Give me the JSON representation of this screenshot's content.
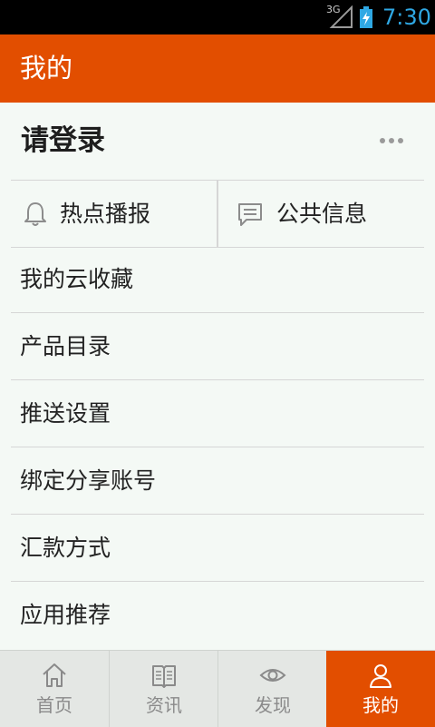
{
  "status_bar": {
    "network": "3G",
    "time": "7:30"
  },
  "app_bar": {
    "title": "我的"
  },
  "login": {
    "label": "请登录",
    "more_icon": "more-dots-icon"
  },
  "quick_actions": [
    {
      "label": "热点播报",
      "icon": "bell-icon"
    },
    {
      "label": "公共信息",
      "icon": "message-icon"
    }
  ],
  "menu": [
    {
      "label": "我的云收藏"
    },
    {
      "label": "产品目录"
    },
    {
      "label": "推送设置"
    },
    {
      "label": "绑定分享账号"
    },
    {
      "label": "汇款方式"
    },
    {
      "label": "应用推荐"
    }
  ],
  "tabs": [
    {
      "label": "首页",
      "icon": "home-icon",
      "active": false
    },
    {
      "label": "资讯",
      "icon": "book-icon",
      "active": false
    },
    {
      "label": "发现",
      "icon": "eye-icon",
      "active": false
    },
    {
      "label": "我的",
      "icon": "person-icon",
      "active": true
    }
  ],
  "colors": {
    "accent": "#e24e00",
    "clock": "#2fa8e4",
    "background": "#f4f9f5",
    "tab_bar": "#e4e7e4"
  }
}
